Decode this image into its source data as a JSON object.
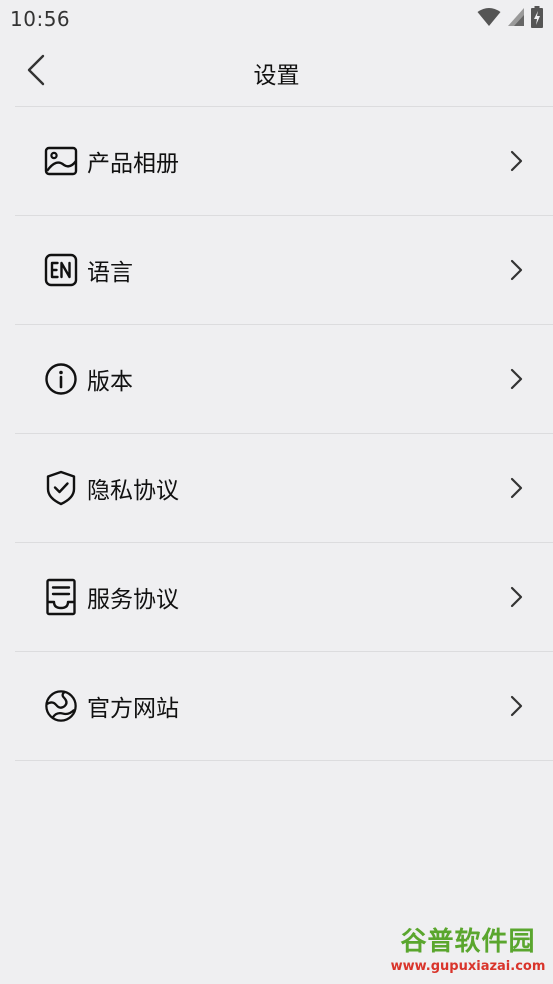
{
  "status_bar": {
    "time": "10:56",
    "icons": [
      "wifi-icon",
      "signal-icon",
      "battery-charging-icon"
    ]
  },
  "nav": {
    "title": "设置",
    "back_icon": "chevron-left-icon"
  },
  "menu": {
    "items": [
      {
        "label": "产品相册",
        "icon": "image-icon"
      },
      {
        "label": "语言",
        "icon": "en-language-icon"
      },
      {
        "label": "版本",
        "icon": "info-icon"
      },
      {
        "label": "隐私协议",
        "icon": "shield-check-icon"
      },
      {
        "label": "服务协议",
        "icon": "document-icon"
      },
      {
        "label": "官方网站",
        "icon": "globe-icon"
      }
    ],
    "chevron_icon": "chevron-right-icon"
  },
  "watermark": {
    "title": "谷普软件园",
    "url": "www.gupuxiazai.com"
  }
}
